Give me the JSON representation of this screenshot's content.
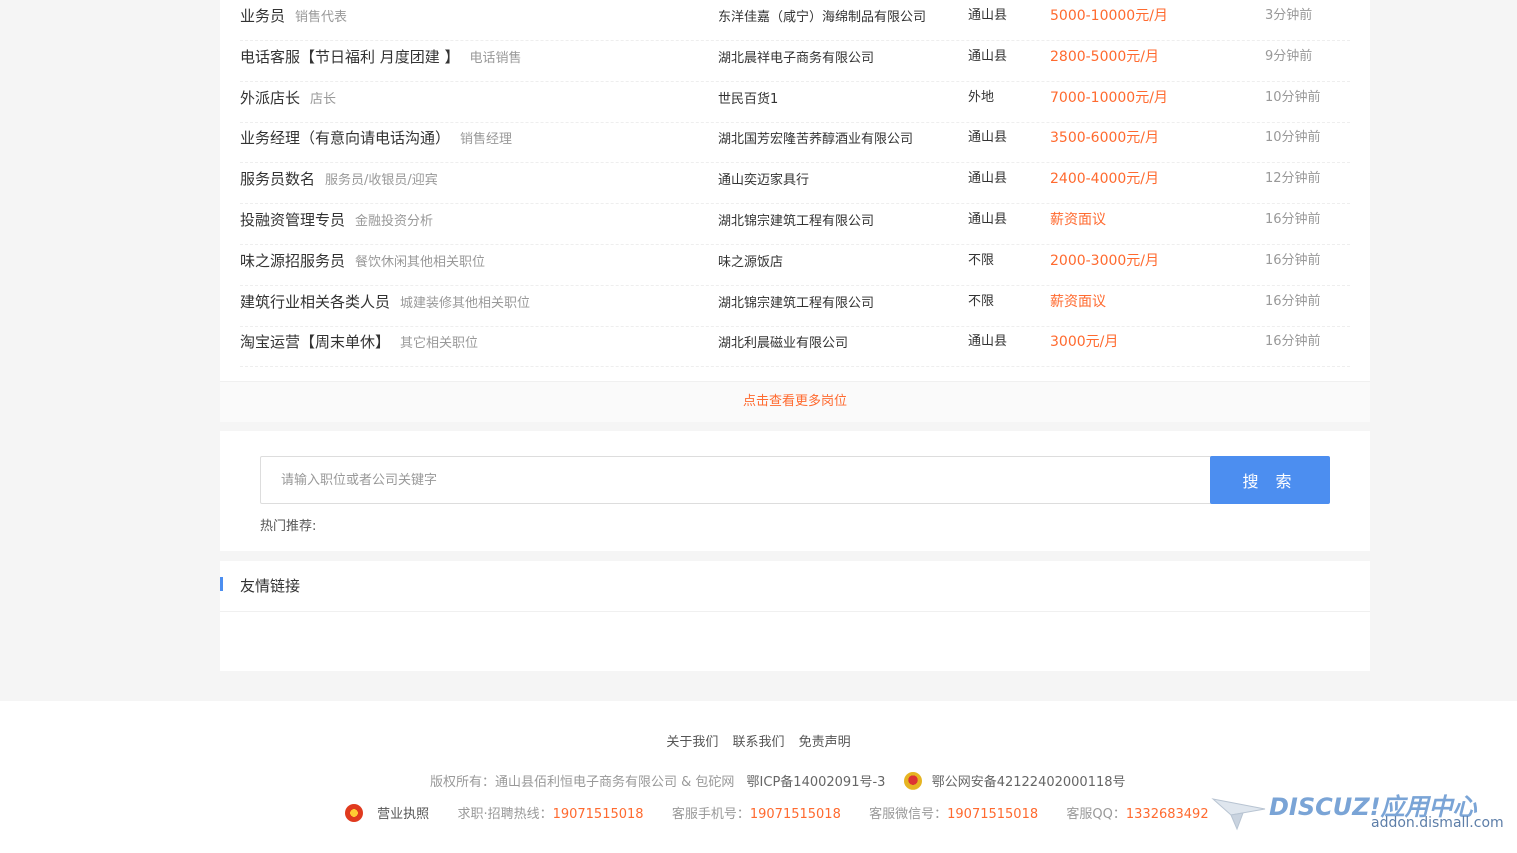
{
  "jobs": [
    {
      "title": "业务员",
      "category": "销售代表",
      "company": "东洋佳嘉（咸宁）海绵制品有限公司",
      "location": "通山县",
      "salary": "5000-10000元/月",
      "time": "3分钟前"
    },
    {
      "title": "电话客服【节日福利 月度团建 】",
      "category": "电话销售",
      "company": "湖北晨祥电子商务有限公司",
      "location": "通山县",
      "salary": "2800-5000元/月",
      "time": "9分钟前"
    },
    {
      "title": "外派店长",
      "category": "店长",
      "company": "世民百货1",
      "location": "外地",
      "salary": "7000-10000元/月",
      "time": "10分钟前"
    },
    {
      "title": "业务经理（有意向请电话沟通）",
      "category": "销售经理",
      "company": "湖北国芳宏隆苦荞醇酒业有限公司",
      "location": "通山县",
      "salary": "3500-6000元/月",
      "time": "10分钟前"
    },
    {
      "title": "服务员数名",
      "category": "服务员/收银员/迎宾",
      "company": "通山奕迈家具行",
      "location": "通山县",
      "salary": "2400-4000元/月",
      "time": "12分钟前"
    },
    {
      "title": "投融资管理专员",
      "category": "金融投资分析",
      "company": "湖北锦宗建筑工程有限公司",
      "location": "通山县",
      "salary": "薪资面议",
      "time": "16分钟前"
    },
    {
      "title": "味之源招服务员",
      "category": "餐饮休闲其他相关职位",
      "company": "味之源饭店",
      "location": "不限",
      "salary": "2000-3000元/月",
      "time": "16分钟前"
    },
    {
      "title": "建筑行业相关各类人员",
      "category": "城建装修其他相关职位",
      "company": "湖北锦宗建筑工程有限公司",
      "location": "不限",
      "salary": "薪资面议",
      "time": "16分钟前"
    },
    {
      "title": "淘宝运营【周末单休】",
      "category": "其它相关职位",
      "company": "湖北利晨磁业有限公司",
      "location": "通山县",
      "salary": "3000元/月",
      "time": "16分钟前"
    }
  ],
  "more_link": "点击查看更多岗位",
  "search": {
    "placeholder": "请输入职位或者公司关键字",
    "button": "搜 索",
    "hot_label": "热门推荐:"
  },
  "links_section": {
    "title": "友情链接"
  },
  "footer": {
    "nav": [
      "关于我们",
      "联系我们",
      "免责声明"
    ],
    "copyright": "版权所有：通山县佰利恒电子商务有限公司 & 包砣网",
    "icp": "鄂ICP备14002091号-3",
    "police": "鄂公网安备42122402000118号",
    "license": "营业执照",
    "hotline_label": "求职·招聘热线：",
    "hotline": "19071515018",
    "mobile_label": "客服手机号：",
    "mobile": "19071515018",
    "wechat_label": "客服微信号：",
    "wechat": "19071515018",
    "qq_label": "客服QQ：",
    "qq": "1332683492"
  },
  "watermark": {
    "title": "DISCUZ!应用中心",
    "url": "addon.dismall.com"
  },
  "colors": {
    "accent": "#4c8ef0",
    "salary": "#ff6a2f",
    "muted": "#999999"
  }
}
